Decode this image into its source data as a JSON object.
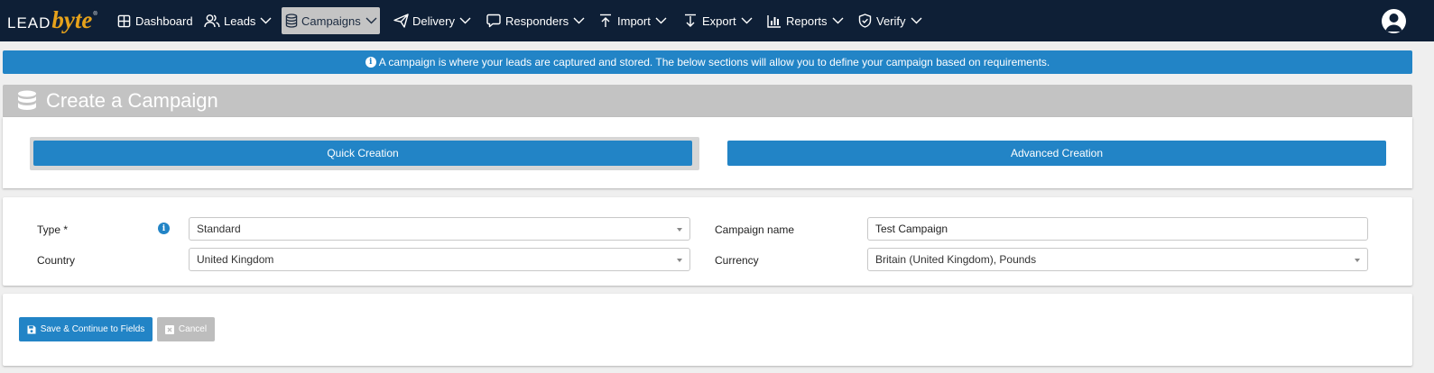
{
  "brand": {
    "part1": "LEAD",
    "part2": "byte",
    "mark": "®"
  },
  "nav": {
    "items": [
      {
        "label": "Dashboard",
        "icon": "dashboard-grid-icon",
        "dropdown": false
      },
      {
        "label": "Leads",
        "icon": "users-icon",
        "dropdown": true
      },
      {
        "label": "Campaigns",
        "icon": "database-icon",
        "dropdown": true,
        "active": true
      },
      {
        "label": "Delivery",
        "icon": "paper-plane-icon",
        "dropdown": true
      },
      {
        "label": "Responders",
        "icon": "speech-bubble-icon",
        "dropdown": true
      },
      {
        "label": "Import",
        "icon": "upload-arrow-icon",
        "dropdown": true
      },
      {
        "label": "Export",
        "icon": "download-arrow-icon",
        "dropdown": true
      },
      {
        "label": "Reports",
        "icon": "bar-chart-icon",
        "dropdown": true
      },
      {
        "label": "Verify",
        "icon": "shield-check-icon",
        "dropdown": true
      }
    ],
    "user_icon": "user-avatar-icon"
  },
  "banner": {
    "text": "A campaign is where your leads are captured and stored. The below sections will allow you to define your campaign based on requirements."
  },
  "page": {
    "title": "Create a Campaign"
  },
  "creation_modes": {
    "quick": "Quick Creation",
    "advanced": "Advanced Creation"
  },
  "form": {
    "type": {
      "label": "Type *",
      "value": "Standard"
    },
    "country": {
      "label": "Country",
      "value": "United Kingdom"
    },
    "campaign_name": {
      "label": "Campaign name",
      "value": "Test Campaign"
    },
    "currency": {
      "label": "Currency",
      "value": "Britain (United Kingdom), Pounds"
    }
  },
  "actions": {
    "save": "Save & Continue to Fields",
    "cancel": "Cancel"
  },
  "colors": {
    "nav_bg": "#0e1f36",
    "accent": "#2284c6",
    "brand_gold": "#e6a21b",
    "active_tab": "#c4c4c4",
    "header_gray": "#c3c3c3"
  }
}
